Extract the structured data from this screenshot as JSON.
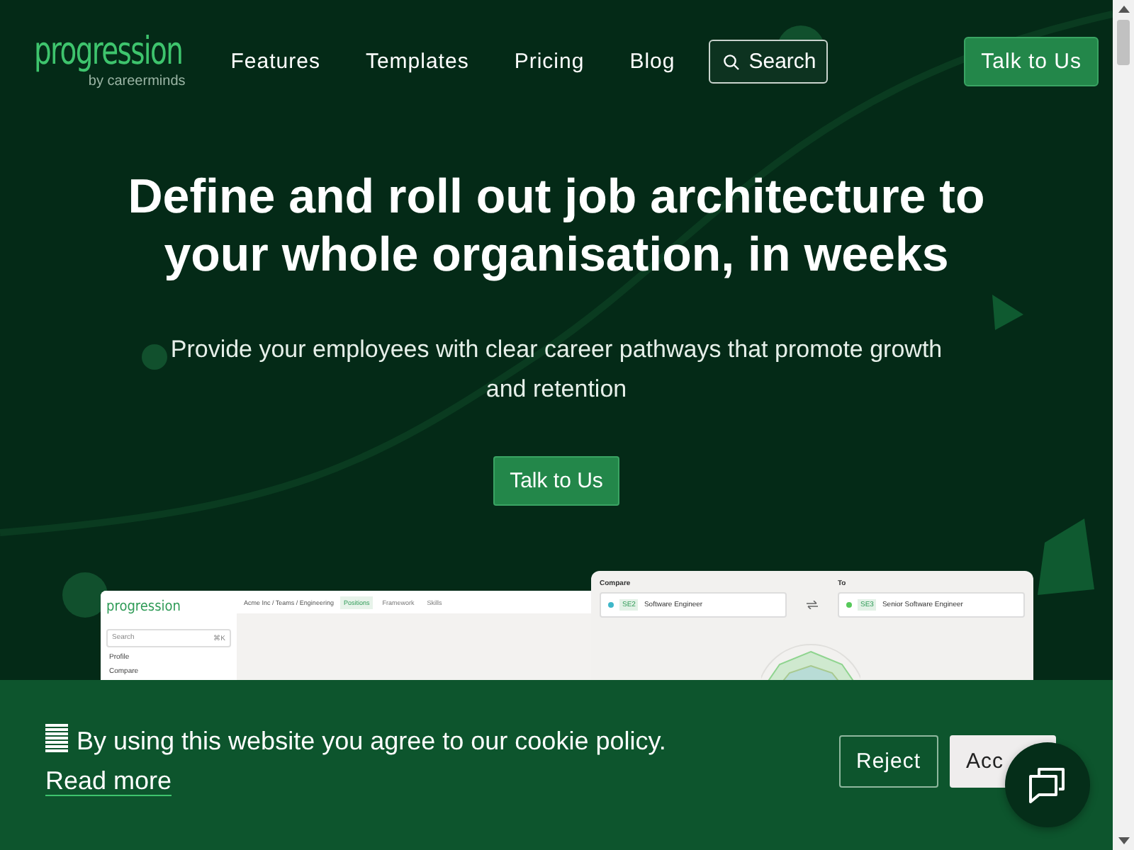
{
  "nav": {
    "logo": "progression",
    "logo_tagline": "by careerminds",
    "links": [
      "Features",
      "Templates",
      "Pricing",
      "Blog"
    ],
    "search": "Search",
    "cta": "Talk to Us"
  },
  "hero": {
    "title": "Define and roll out job architecture to your whole organisation, in weeks",
    "subtitle": "Provide your employees with clear career pathways that promote growth and retention",
    "cta": "Talk to Us"
  },
  "preview": {
    "sidebar": {
      "logo": "progression",
      "search": "Search",
      "shortcut": "⌘K",
      "items": [
        "Profile",
        "Compare"
      ]
    },
    "breadcrumb": "Acme Inc / Teams / Engineering",
    "tabs": [
      {
        "label": "Positions",
        "selected": true
      },
      {
        "label": "Framework",
        "selected": false
      },
      {
        "label": "Skills",
        "selected": false
      }
    ],
    "compare": {
      "from_label": "Compare",
      "to_label": "To",
      "from": {
        "code": "SE2",
        "title": "Software Engineer",
        "color": "#3fb7c9"
      },
      "to": {
        "code": "SE3",
        "title": "Senior Software Engineer",
        "color": "#56c95a"
      }
    }
  },
  "cookie_banner": {
    "message": "By using this website you agree to our cookie policy.",
    "link": "Read more",
    "buttons": [
      {
        "label": "Reject",
        "kind": "outline"
      },
      {
        "label": "Acc",
        "kind": "filled"
      }
    ]
  }
}
